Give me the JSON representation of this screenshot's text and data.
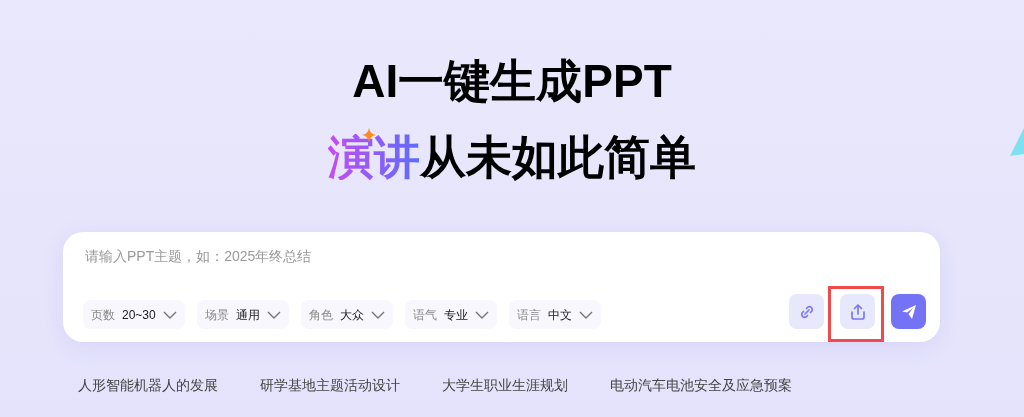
{
  "heading": "AI一键生成PPT",
  "subheading": {
    "highlight": "演讲",
    "rest": "从未如此简单"
  },
  "prompt": {
    "placeholder": "请输入PPT主题，如：2025年终总结"
  },
  "options": [
    {
      "label": "页数",
      "value": "20~30"
    },
    {
      "label": "场景",
      "value": "通用"
    },
    {
      "label": "角色",
      "value": "大众"
    },
    {
      "label": "语气",
      "value": "专业"
    },
    {
      "label": "语言",
      "value": "中文"
    }
  ],
  "actions": [
    {
      "kind": "link",
      "highlighted": false
    },
    {
      "kind": "upload",
      "highlighted": true
    },
    {
      "kind": "send",
      "highlighted": false
    }
  ],
  "suggestions": [
    "人形智能机器人的发展",
    "研学基地主题活动设计",
    "大学生职业生涯规划",
    "电动汽车电池安全及应急预案"
  ]
}
